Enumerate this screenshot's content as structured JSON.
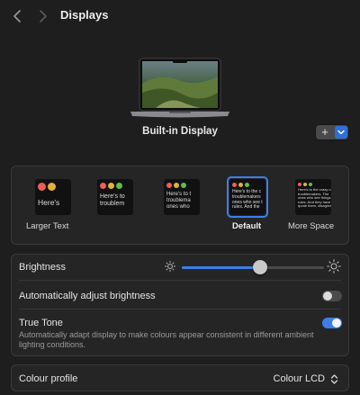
{
  "window": {
    "title": "Displays"
  },
  "display": {
    "name": "Built-in Display",
    "add_label": "+"
  },
  "resolution": {
    "options": [
      {
        "label": "Larger Text",
        "preview": "Here's"
      },
      {
        "label": "",
        "preview": "Here's to\ntroublem"
      },
      {
        "label": "",
        "preview": "Here's to t\ntroublema\nones who"
      },
      {
        "label": "Default",
        "preview": "Here's to the c\ntroublemakers\nones who see t\nrules. And the"
      },
      {
        "label": "More Space",
        "preview": "Here's to the crazy o\ntroublemakers. The\nones who see things\nrules. And they have\nquote them, disagree"
      }
    ],
    "selected_index": 3
  },
  "brightness": {
    "label": "Brightness",
    "level_percent": 55
  },
  "auto_brightness": {
    "label": "Automatically adjust brightness",
    "enabled": false
  },
  "true_tone": {
    "label": "True Tone",
    "description": "Automatically adapt display to make colours appear consistent in different ambient lighting conditions.",
    "enabled": true
  },
  "colour_profile": {
    "label": "Colour profile",
    "value": "Colour LCD"
  },
  "colors": {
    "accent": "#3d7eea",
    "traffic_red": "#ec5f57",
    "traffic_yellow": "#e0b23b",
    "traffic_green": "#5fbf4a"
  }
}
